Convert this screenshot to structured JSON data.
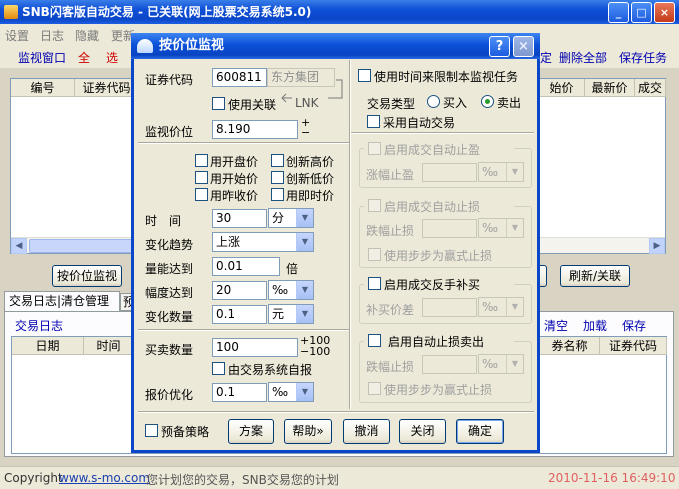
{
  "main": {
    "title": "SNB闪客版自动交易 - 已关联(网上股票交易系统5.0)",
    "menu": [
      "设置",
      "日志",
      "隐藏",
      "更新"
    ],
    "toolbar_left": {
      "title": "监视窗口",
      "all": "全",
      "select": "选"
    },
    "toolbar_right": {
      "confirm_frag": "定",
      "delete_all": "删除全部",
      "save_task": "保存任务"
    },
    "table_headers_left": [
      "编号",
      "证券代码"
    ],
    "table_headers_right": [
      "始价",
      "最新价",
      "成交"
    ],
    "price_monitor_button": "按价位监视",
    "refresh_button": "刷新/关联",
    "tabs": [
      "交易日志|清仓管理",
      "预"
    ],
    "log_title": "交易日志",
    "log_actions": [
      "清空",
      "加载",
      "保存"
    ],
    "log_headers_left": [
      "日期",
      "时间"
    ],
    "log_headers_right": [
      "券名称",
      "证券代码"
    ],
    "status": {
      "copyright": "Copyright ",
      "url": "www.s-mo.com",
      "slogan": " 您计划您的交易，SNB交易您的计划",
      "datetime": "2010-11-16 16:49:10"
    }
  },
  "dialog": {
    "title": "按价位监视",
    "help_button": "?",
    "close_button": "×",
    "stock_code_label": "证券代码",
    "stock_code": "600811",
    "stock_name": "东方集团",
    "use_link_label": "使用关联",
    "lnk_label": "LNK",
    "monitor_price_label": "监视价位",
    "monitor_price": "8.190",
    "price_options": [
      "用开盘价",
      "创新高价",
      "用开始价",
      "创新低价",
      "用昨收价",
      "用即时价"
    ],
    "time_label": "时　间",
    "time_value": "30",
    "time_unit": "分",
    "trend_label": "变化趋势",
    "trend_value": "上涨",
    "volume_label": "量能达到",
    "volume_value": "0.01",
    "volume_unit": "倍",
    "amplitude_label": "幅度达到",
    "amplitude_value": "20",
    "amplitude_unit": "‰",
    "change_qty_label": "变化数量",
    "change_qty_value": "0.1",
    "change_qty_unit": "元",
    "trade_qty_label": "买卖数量",
    "trade_qty_value": "100",
    "trade_qty_plus": "+100",
    "trade_qty_minus": "−100",
    "system_report_label": "由交易系统自报",
    "quote_opt_label": "报价优化",
    "quote_opt_value": "0.1",
    "quote_opt_unit": "‰",
    "preset_strategy_label": "预备策略",
    "time_limit_label": "使用时间来限制本监视任务",
    "trade_type_label": "交易类型",
    "buy_label": "买入",
    "sell_label": "卖出",
    "auto_trade_label": "采用自动交易",
    "take_profit_label": "启用成交自动止盈",
    "rise_label": "涨幅止盈",
    "stop_loss_label": "启用成交自动止损",
    "fall_label": "跌幅止损",
    "step_label": "使用步步为赢式止损",
    "reverse_buy_label": "启用成交反手补买",
    "buy_diff_label": "补买价差",
    "auto_stop_sell_label": "启用自动止损卖出",
    "fall_label2": "跌幅止损",
    "step_label2": "使用步步为赢式止损",
    "permil": "‰",
    "buttons": [
      "方案",
      "帮助»",
      "撤消",
      "关闭",
      "确定"
    ]
  }
}
